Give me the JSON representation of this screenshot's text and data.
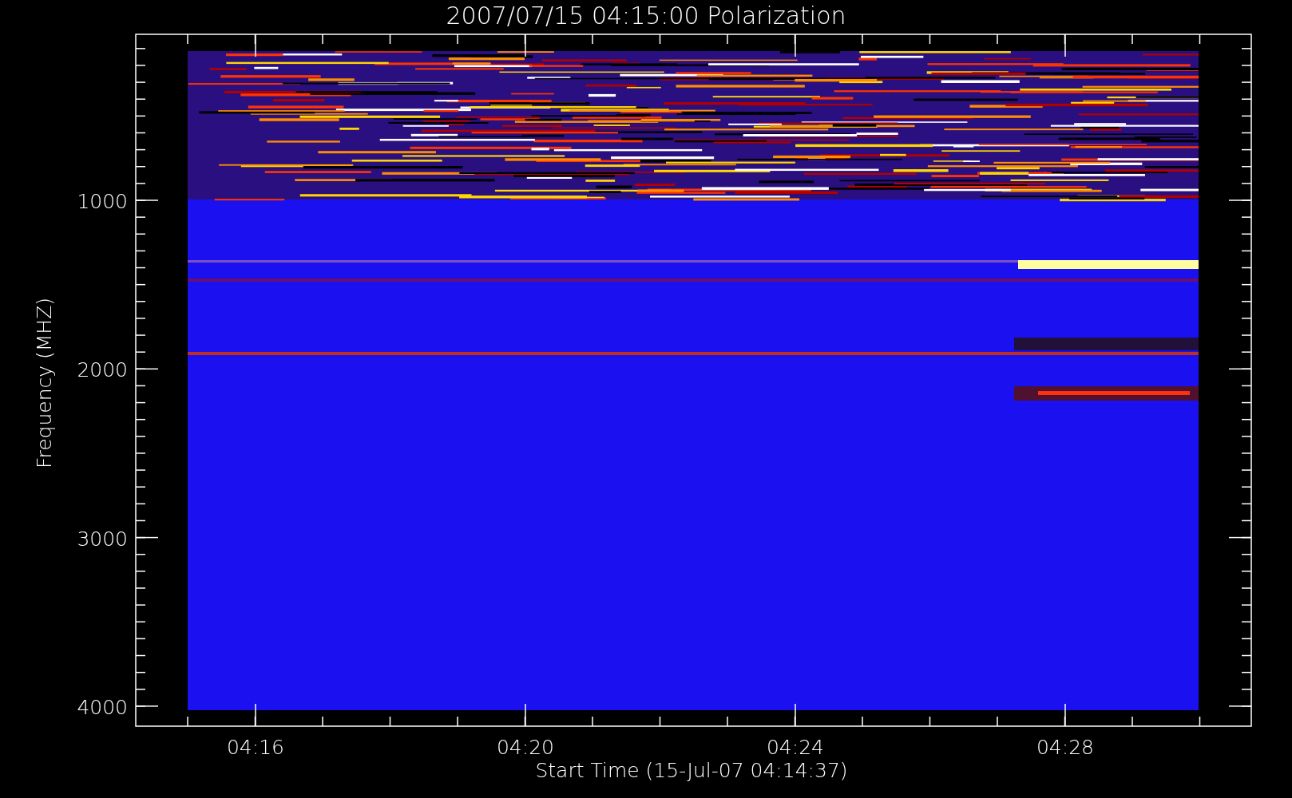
{
  "title": "2007/07/15 04:15:00 Polarization",
  "x_axis": {
    "label": "Start Time (15-Jul-07 04:14:37)",
    "tick_labels": [
      "04:16",
      "04:20",
      "04:24",
      "04:28"
    ]
  },
  "y_axis": {
    "label": "Frequency (MHZ)",
    "tick_labels": [
      "1000",
      "2000",
      "3000",
      "4000"
    ]
  }
}
